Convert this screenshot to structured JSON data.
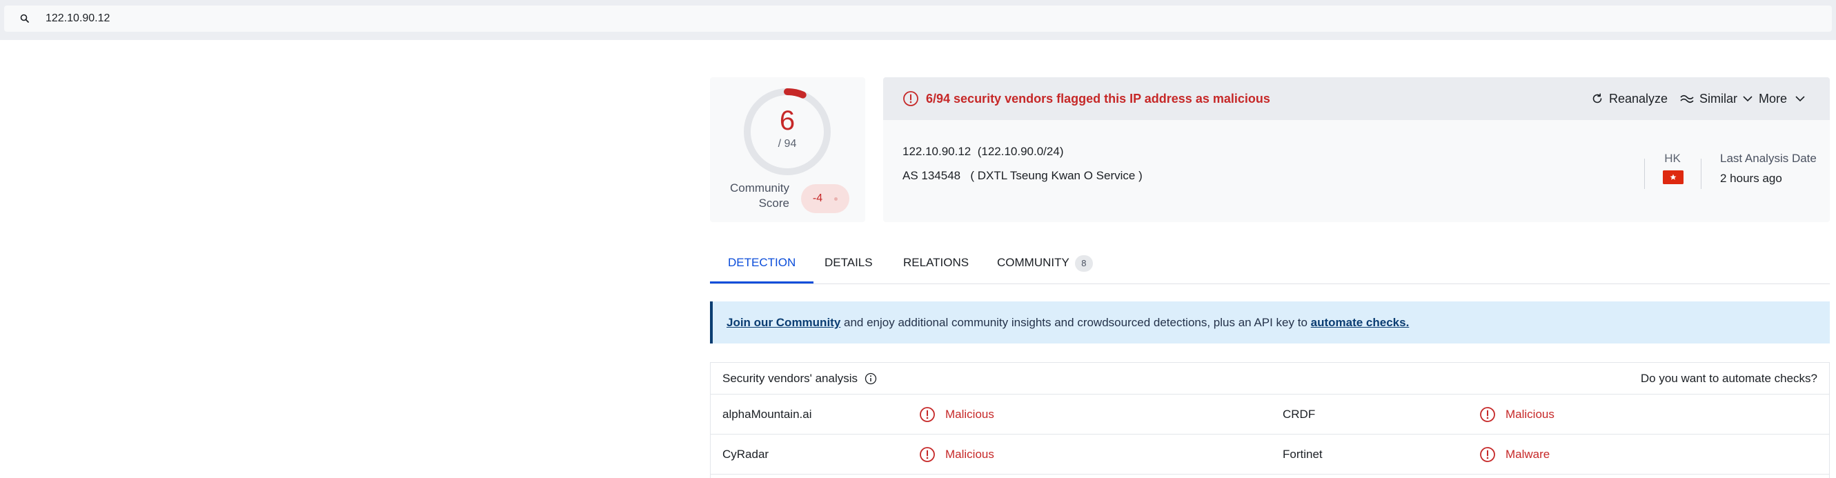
{
  "search": {
    "value": "122.10.90.12"
  },
  "score": {
    "detections": "6",
    "total": "/ 94",
    "detections_num": 6,
    "total_num": 94,
    "community_label": "Community Score",
    "community_value": "-4"
  },
  "header": {
    "alert": "6/94 security vendors flagged this IP address as malicious",
    "reanalyze": "Reanalyze",
    "similar": "Similar",
    "more": "More"
  },
  "ip_info": {
    "ip": "122.10.90.12",
    "network": "(122.10.90.0/24)",
    "as_number": "AS 134548",
    "as_name": "( DXTL Tseung Kwan O Service )",
    "country": "HK",
    "last_analysis_label": "Last Analysis Date",
    "last_analysis_value": "2 hours ago"
  },
  "tabs": [
    {
      "label": "DETECTION",
      "active": true
    },
    {
      "label": "DETAILS"
    },
    {
      "label": "RELATIONS"
    },
    {
      "label": "COMMUNITY",
      "count": "8"
    }
  ],
  "banner": {
    "link1": "Join our Community",
    "middle": " and enjoy additional community insights and crowdsourced detections, plus an API key to ",
    "link2": "automate checks."
  },
  "vendors": {
    "title": "Security vendors' analysis",
    "automate_prompt": "Do you want to automate checks?",
    "rows": [
      {
        "left_name": "alphaMountain.ai",
        "left_result": "Malicious",
        "right_name": "CRDF",
        "right_result": "Malicious"
      },
      {
        "left_name": "CyRadar",
        "left_result": "Malicious",
        "right_name": "Fortinet",
        "right_result": "Malware"
      }
    ]
  },
  "colors": {
    "danger": "#c62828",
    "accent": "#0b4dda",
    "banner_bg": "#dceefb"
  },
  "icons": [
    "search-icon",
    "alert-icon",
    "reanalyze-icon",
    "similar-icon",
    "chevron-down-icon",
    "info-icon",
    "hk-flag-icon"
  ]
}
